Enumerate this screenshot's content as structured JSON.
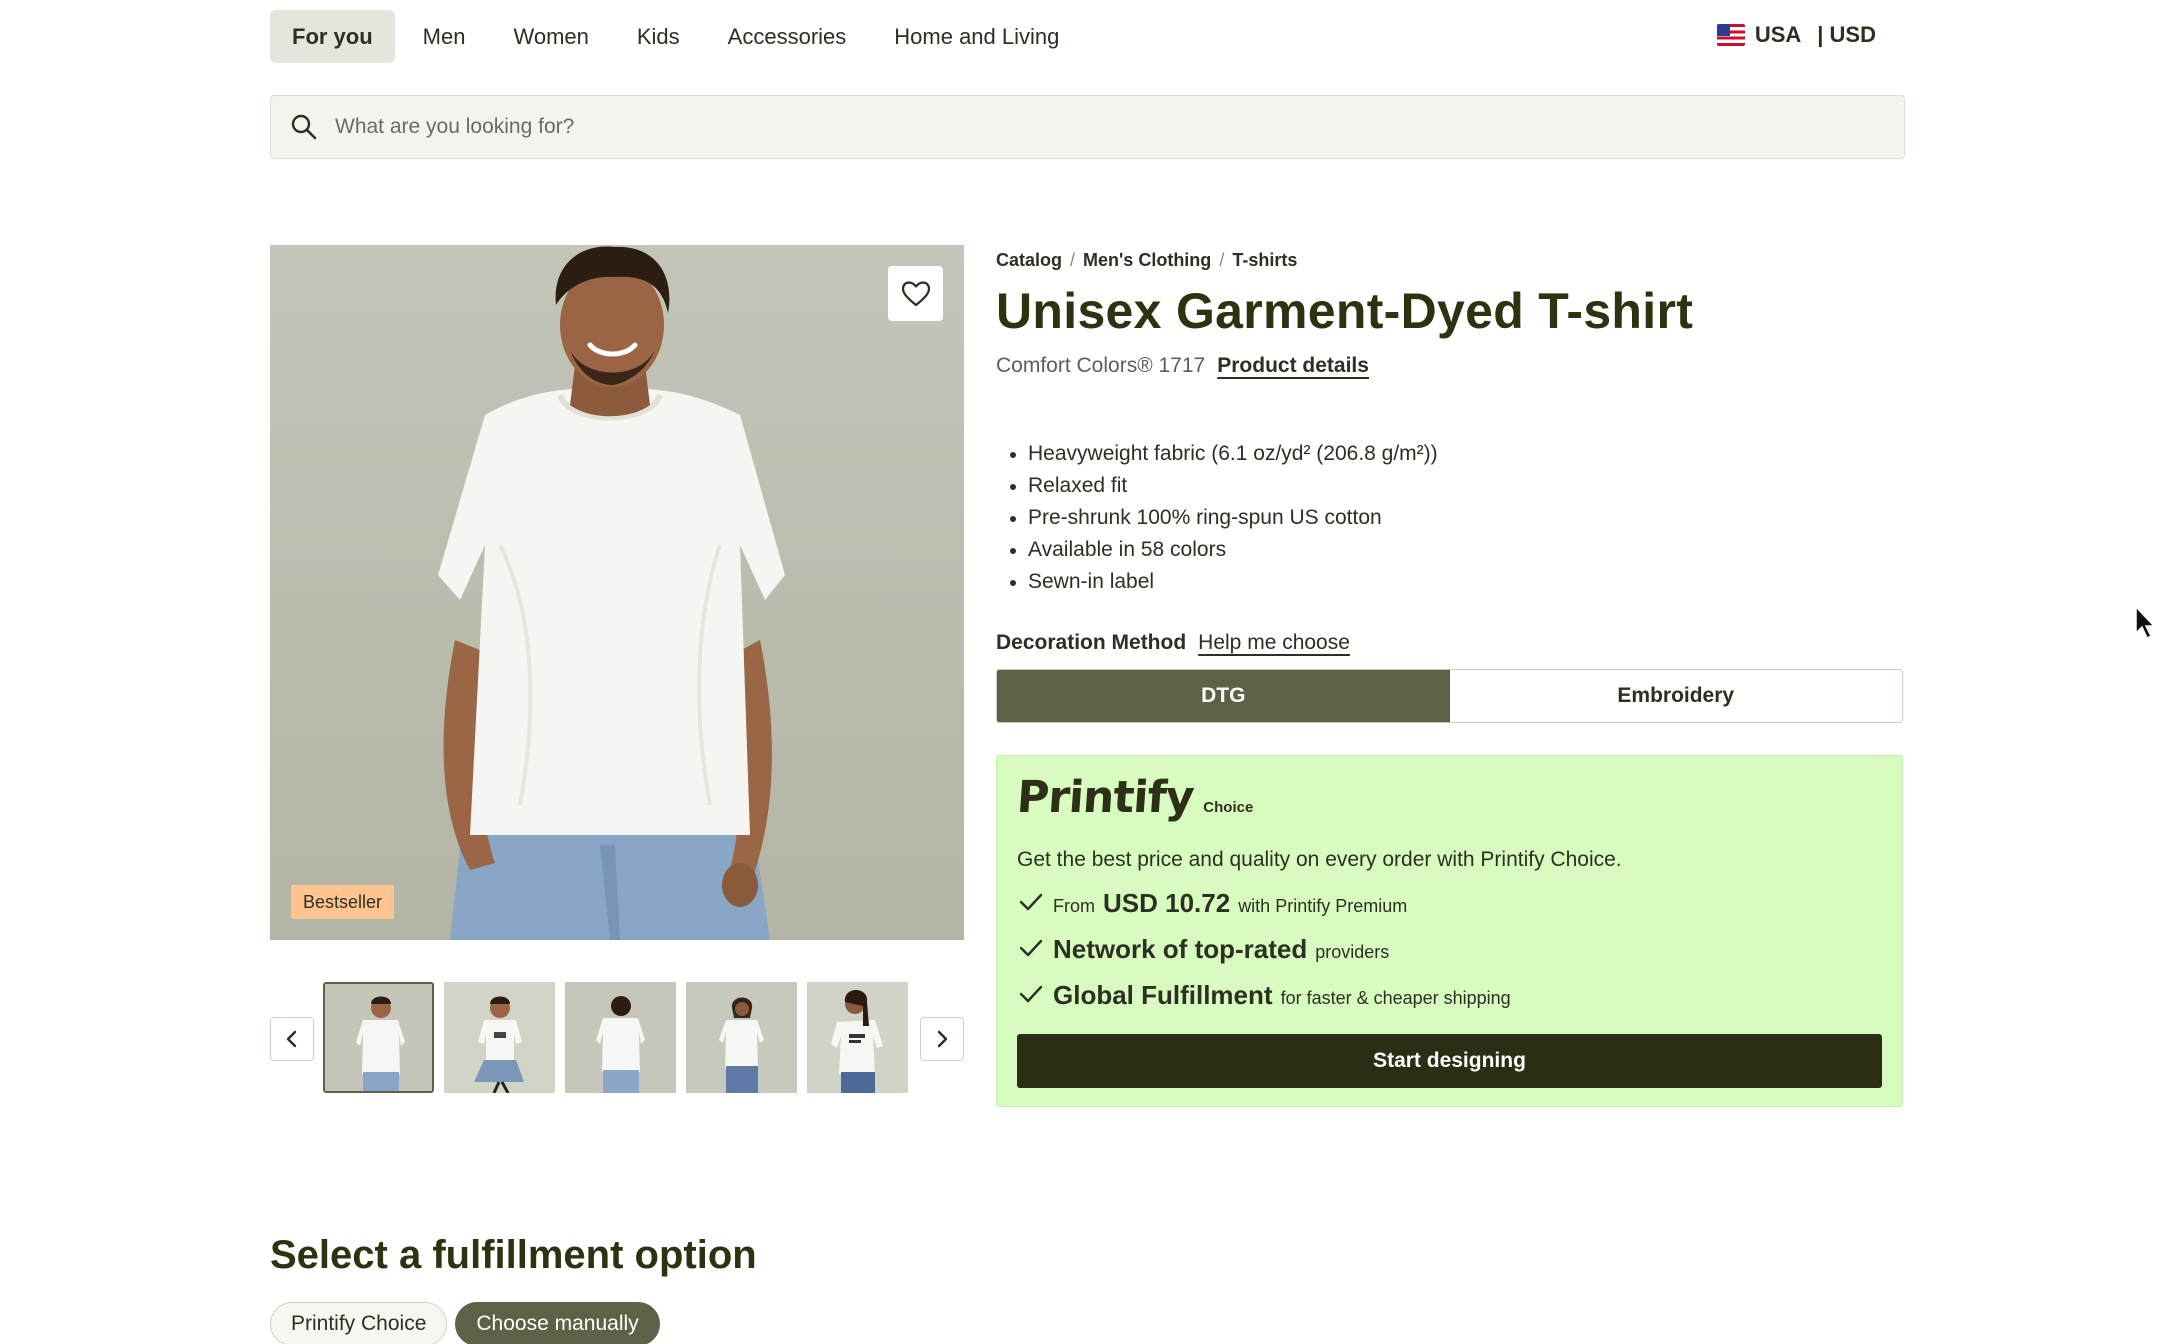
{
  "nav": {
    "items": [
      {
        "label": "For you",
        "active": true
      },
      {
        "label": "Men",
        "active": false
      },
      {
        "label": "Women",
        "active": false
      },
      {
        "label": "Kids",
        "active": false
      },
      {
        "label": "Accessories",
        "active": false
      },
      {
        "label": "Home and Living",
        "active": false
      }
    ],
    "locale": {
      "country": "USA",
      "currency": "| USD",
      "flag_icon": "us-flag-icon"
    }
  },
  "search": {
    "placeholder": "What are you looking for?",
    "value": "",
    "icon": "search-icon"
  },
  "gallery": {
    "badge": "Bestseller",
    "favorite_icon": "heart-icon",
    "prev_icon": "chevron-left-icon",
    "next_icon": "chevron-right-icon",
    "thumbnails": [
      "front",
      "seated",
      "back",
      "front-female",
      "side-female"
    ],
    "active_thumbnail": 0
  },
  "product": {
    "breadcrumb": [
      "Catalog",
      "Men's Clothing",
      "T-shirts"
    ],
    "title": "Unisex Garment-Dyed T-shirt",
    "brand": "Comfort Colors® 1717",
    "details_link": "Product details",
    "features": [
      "Heavyweight fabric (6.1 oz/yd² (206.8 g/m²))",
      "Relaxed fit",
      "Pre-shrunk 100% ring-spun US cotton",
      "Available in 58 colors",
      "Sewn-in label"
    ],
    "decoration": {
      "label": "Decoration Method",
      "help_link": "Help me choose",
      "options": [
        "DTG",
        "Embroidery"
      ],
      "selected": "DTG"
    }
  },
  "choice_card": {
    "logo_word": "Printify",
    "logo_tag": "Choice",
    "intro": "Get the best price and quality on every order with Printify Choice.",
    "perks": [
      {
        "pre": "From",
        "strong": "USD 10.72",
        "post": "with Printify Premium"
      },
      {
        "pre": "",
        "strong": "Network of top-rated",
        "post": "providers"
      },
      {
        "pre": "",
        "strong": "Global Fulfillment",
        "post": "for faster & cheaper shipping"
      }
    ],
    "check_icon": "check-icon",
    "cta": "Start designing",
    "background": "#d8fcbf"
  },
  "fulfillment": {
    "title": "Select a fulfillment option",
    "options": [
      "Printify Choice",
      "Choose manually"
    ],
    "selected": "Choose manually"
  },
  "colors": {
    "accent": "#5f6147",
    "dark_button": "#2b2d15",
    "badge": "#ffc48f"
  }
}
